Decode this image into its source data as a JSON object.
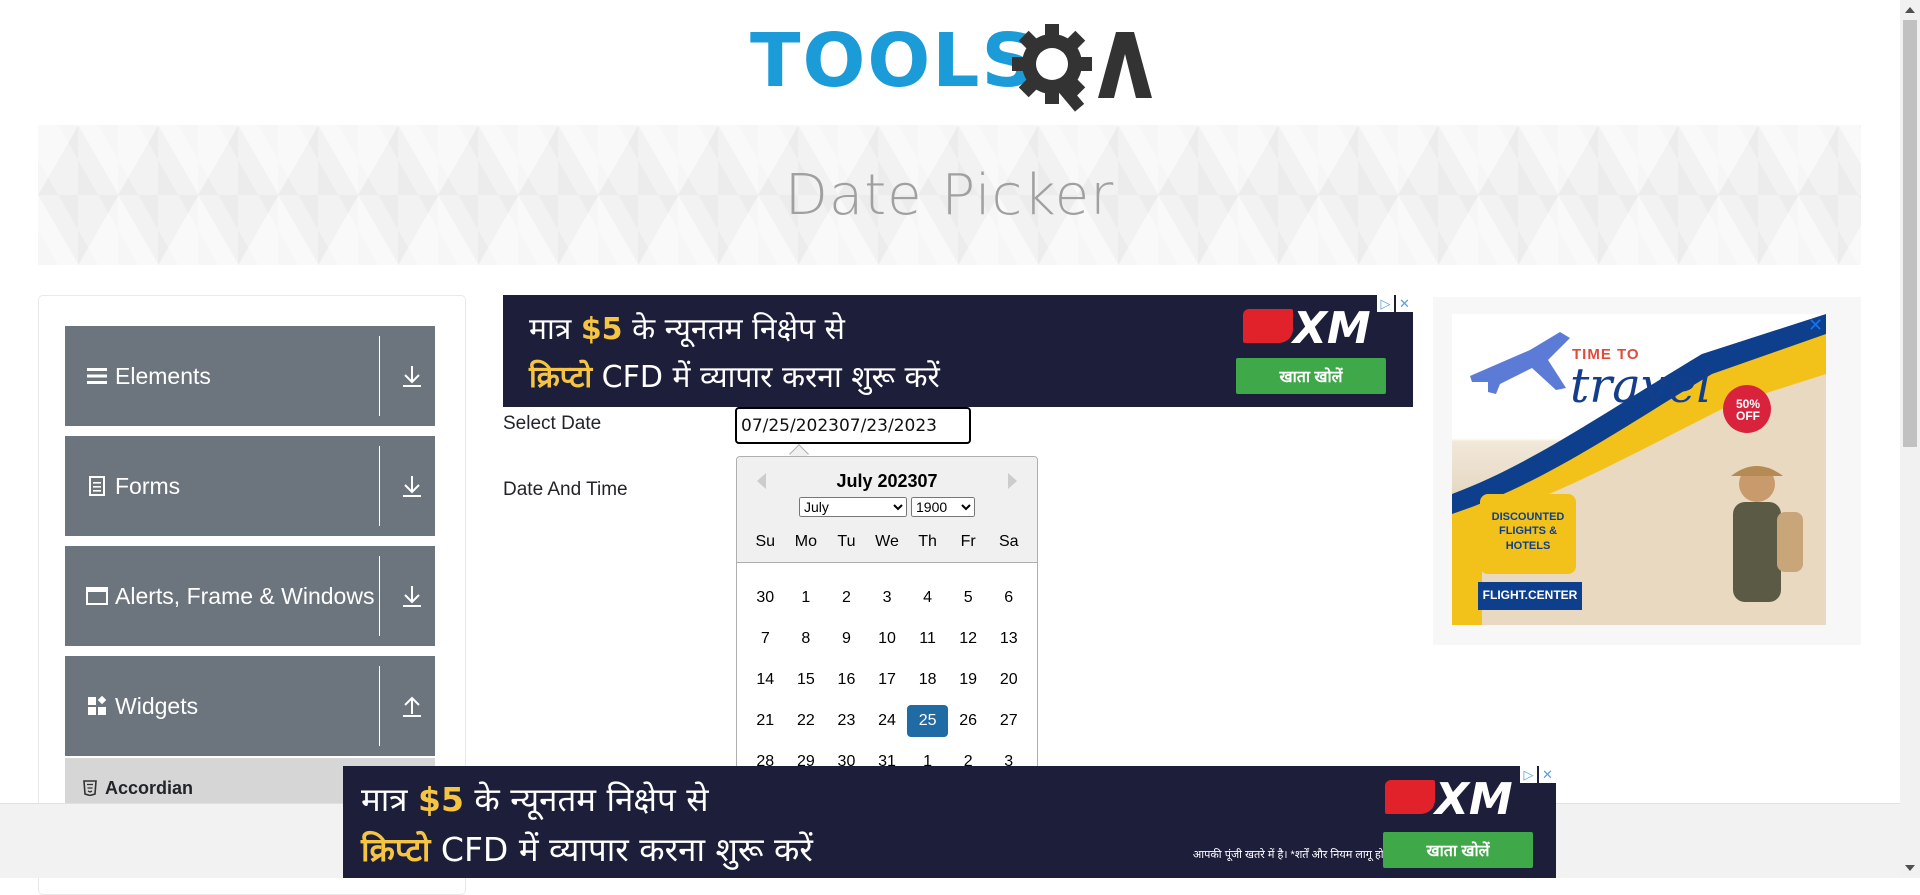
{
  "header": {
    "logo_text": "TOOLS",
    "logo_qa": "QA",
    "page_title": "Date Picker"
  },
  "sidebar": {
    "groups": [
      {
        "label": "Elements",
        "icon": "hamburger-icon",
        "toggle": "download-arrow-icon"
      },
      {
        "label": "Forms",
        "icon": "document-icon",
        "toggle": "download-arrow-icon"
      },
      {
        "label": "Alerts, Frame & Windows",
        "icon": "window-icon",
        "toggle": "download-arrow-icon"
      },
      {
        "label": "Widgets",
        "icon": "widgets-icon",
        "toggle": "upload-arrow-icon"
      }
    ],
    "active_item": {
      "label": "Accordian",
      "icon": "html5-icon"
    }
  },
  "form": {
    "select_date_label": "Select Date",
    "date_time_label": "Date And Time",
    "select_date_value": "07/25/202307/23/2023"
  },
  "datepicker": {
    "month_title": "July 202307",
    "month_select": "July",
    "year_select": "1900",
    "weekdays": [
      "Su",
      "Mo",
      "Tu",
      "We",
      "Th",
      "Fr",
      "Sa"
    ],
    "weeks": [
      [
        "30",
        "1",
        "2",
        "3",
        "4",
        "5",
        "6"
      ],
      [
        "7",
        "8",
        "9",
        "10",
        "11",
        "12",
        "13"
      ],
      [
        "14",
        "15",
        "16",
        "17",
        "18",
        "19",
        "20"
      ],
      [
        "21",
        "22",
        "23",
        "24",
        "25",
        "26",
        "27"
      ],
      [
        "28",
        "29",
        "30",
        "31",
        "1",
        "2",
        "3"
      ]
    ],
    "selected_day": "25",
    "selected_color": "#216ba5"
  },
  "ads": {
    "xm": {
      "line1_pre": "मात्र ",
      "line1_amount": "$5",
      "line1_post": " के न्यूनतम निक्षेप से",
      "line2_hl": "क्रिप्टो",
      "line2_post": " CFD में  व्यापार करना शुरू करें",
      "brand": "XM",
      "disclaimer1": "आपकी पूंजी खतरे में है।",
      "disclaimer2": "*शर्तें और नियम लागू होते हैं।",
      "disclaimer_bottom": "आपकी पूंजी खतरे में है। *शर्तें और नियम लागू होते हैं।",
      "cta": "खाता खोलें"
    },
    "travel": {
      "line1": "TIME TO",
      "line2": "travel",
      "badge_top": "50%",
      "badge_bottom": "OFF",
      "bubble": "DISCOUNTED FLIGHTS & HOTELS",
      "brand": "FLIGHT.CENTER"
    }
  }
}
